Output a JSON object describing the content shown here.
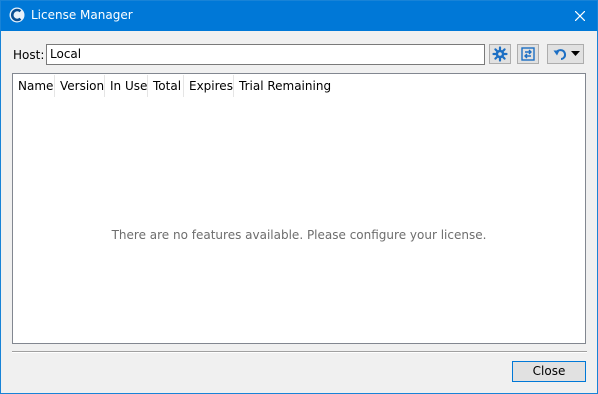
{
  "window": {
    "title": "License Manager",
    "app_icon": "app-logo-icon",
    "close_icon": "close-icon"
  },
  "host": {
    "label": "Host:",
    "value": "Local"
  },
  "toolbar": {
    "settings_icon": "gear-icon",
    "refresh_icon": "swap-refresh-icon",
    "undo_icon": "undo-icon",
    "dropdown_icon": "chevron-down-icon"
  },
  "table": {
    "columns": [
      "Name",
      "Version",
      "In Use",
      "Total",
      "Expires",
      "Trial Remaining"
    ],
    "rows": [],
    "empty_message": "There are no features available. Please configure your license."
  },
  "footer": {
    "close_label": "Close"
  },
  "colors": {
    "titlebar": "#0078d7",
    "accent_border": "#0078d7",
    "empty_text": "#6d6d6d"
  }
}
